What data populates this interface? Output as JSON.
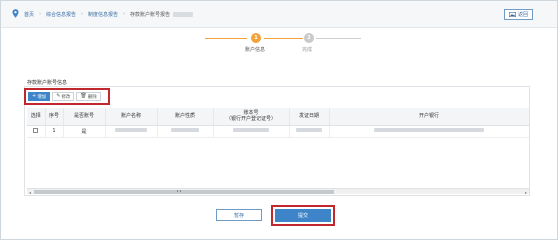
{
  "breadcrumb": {
    "items": [
      "首页",
      "综合信息报告",
      "制度信息报告",
      "存款账户账号报告"
    ],
    "current": "存款账户账号报告"
  },
  "back_button": {
    "label": "返回"
  },
  "steps": [
    {
      "number": "1",
      "label": "账户信息",
      "state": "active"
    },
    {
      "number": "2",
      "label": "完成",
      "state": "pending"
    }
  ],
  "section": {
    "title": "存款账户账号信息"
  },
  "toolbar": {
    "add_label": "增加",
    "edit_label": "修改",
    "delete_label": "删除"
  },
  "table": {
    "headers": {
      "select": "选择",
      "seq": "序号",
      "is_main": "是否账号",
      "account_name": "账户名称",
      "account_nature": "账户性质",
      "account_no_line1": "账本号",
      "account_no_line2": "（银行开户登记证号）",
      "issue_date": "发证日期",
      "bank": "开户银行"
    },
    "rows": [
      {
        "seq": "1",
        "is_main": "是"
      }
    ]
  },
  "actions": {
    "save_label": "暂存",
    "submit_label": "提交"
  },
  "colors": {
    "accent": "#3d84c8",
    "step_active": "#f2a33a",
    "highlight_box": "#c0282e"
  },
  "icons": {
    "location": "location-pin-icon",
    "back": "image-icon",
    "add": "plus-icon",
    "edit": "pencil-icon",
    "delete": "trash-icon"
  }
}
